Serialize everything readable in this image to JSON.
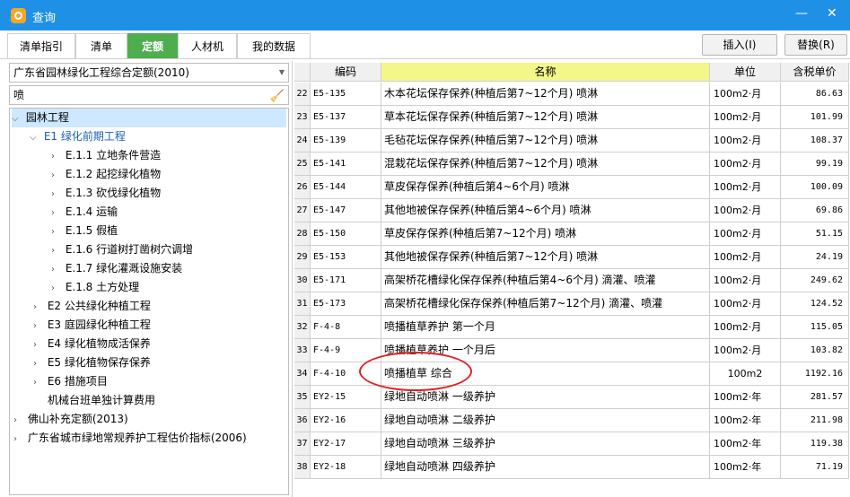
{
  "window": {
    "title": "查询",
    "minimize": "—",
    "close": "✕"
  },
  "tabs": [
    {
      "label": "清单指引"
    },
    {
      "label": "清单"
    },
    {
      "label": "定额"
    },
    {
      "label": "人材机"
    },
    {
      "label": "我的数据"
    }
  ],
  "toolbar": {
    "insert_label": "插入(I)",
    "replace_label": "替换(R)"
  },
  "left": {
    "library_select": "广东省园林绿化工程综合定额(2010)",
    "search_value": "喷",
    "tree": [
      {
        "label": "园林工程"
      },
      {
        "label": "E1 绿化前期工程"
      },
      {
        "label": "E.1.1 立地条件营造"
      },
      {
        "label": "E.1.2 起挖绿化植物"
      },
      {
        "label": "E.1.3 砍伐绿化植物"
      },
      {
        "label": "E.1.4 运输"
      },
      {
        "label": "E.1.5 假植"
      },
      {
        "label": "E.1.6 行道树打凿树穴调增"
      },
      {
        "label": "E.1.7 绿化灌溉设施安装"
      },
      {
        "label": "E.1.8 土方处理"
      },
      {
        "label": "E2 公共绿化种植工程"
      },
      {
        "label": "E3 庭园绿化种植工程"
      },
      {
        "label": "E4 绿化植物成活保养"
      },
      {
        "label": "E5 绿化植物保存保养"
      },
      {
        "label": "E6 措施项目"
      },
      {
        "label": "机械台班单独计算费用"
      },
      {
        "label": "佛山补充定额(2013)"
      },
      {
        "label": "广东省城市绿地常规养护工程估价指标(2006)"
      }
    ]
  },
  "table": {
    "headers": {
      "code": "编码",
      "name": "名称",
      "unit": "单位",
      "price": "含税单价"
    },
    "rows": [
      {
        "no": "22",
        "code": "E5-135",
        "name": "木本花坛保存保养(种植后第7~12个月) 喷淋",
        "unit": "100m2·月",
        "price": "86.63"
      },
      {
        "no": "23",
        "code": "E5-137",
        "name": "草本花坛保存保养(种植后第7~12个月) 喷淋",
        "unit": "100m2·月",
        "price": "101.99"
      },
      {
        "no": "24",
        "code": "E5-139",
        "name": "毛毡花坛保存保养(种植后第7~12个月) 喷淋",
        "unit": "100m2·月",
        "price": "108.37"
      },
      {
        "no": "25",
        "code": "E5-141",
        "name": "混栽花坛保存保养(种植后第7~12个月) 喷淋",
        "unit": "100m2·月",
        "price": "99.19"
      },
      {
        "no": "26",
        "code": "E5-144",
        "name": "草皮保存保养(种植后第4~6个月) 喷淋",
        "unit": "100m2·月",
        "price": "100.09"
      },
      {
        "no": "27",
        "code": "E5-147",
        "name": "其他地被保存保养(种植后第4~6个月) 喷淋",
        "unit": "100m2·月",
        "price": "69.86"
      },
      {
        "no": "28",
        "code": "E5-150",
        "name": "草皮保存保养(种植后第7~12个月) 喷淋",
        "unit": "100m2·月",
        "price": "51.15"
      },
      {
        "no": "29",
        "code": "E5-153",
        "name": "其他地被保存保养(种植后第7~12个月) 喷淋",
        "unit": "100m2·月",
        "price": "24.19"
      },
      {
        "no": "30",
        "code": "E5-171",
        "name": "高架桥花槽绿化保存保养(种植后第4~6个月) 滴灌、喷灌",
        "unit": "100m2·月",
        "price": "249.62"
      },
      {
        "no": "31",
        "code": "E5-173",
        "name": "高架桥花槽绿化保存保养(种植后第7~12个月) 滴灌、喷灌",
        "unit": "100m2·月",
        "price": "124.52"
      },
      {
        "no": "32",
        "code": "F-4-8",
        "name": "喷播植草养护 第一个月",
        "unit": "100m2·月",
        "price": "115.05"
      },
      {
        "no": "33",
        "code": "F-4-9",
        "name": "喷播植草养护 一个月后",
        "unit": "100m2·月",
        "price": "103.82"
      },
      {
        "no": "34",
        "code": "F-4-10",
        "name": "喷播植草 综合",
        "unit": "100m2",
        "price": "1192.16"
      },
      {
        "no": "35",
        "code": "EY2-15",
        "name": "绿地自动喷淋 一级养护",
        "unit": "100m2·年",
        "price": "281.57"
      },
      {
        "no": "36",
        "code": "EY2-16",
        "name": "绿地自动喷淋 二级养护",
        "unit": "100m2·年",
        "price": "211.98"
      },
      {
        "no": "37",
        "code": "EY2-17",
        "name": "绿地自动喷淋 三级养护",
        "unit": "100m2·年",
        "price": "119.38"
      },
      {
        "no": "38",
        "code": "EY2-18",
        "name": "绿地自动喷淋 四级养护",
        "unit": "100m2·年",
        "price": "71.19"
      }
    ]
  },
  "colors": {
    "titlebar": "#1e90e6",
    "active_tab": "#4eae4e",
    "name_header": "#f3f78a",
    "annotation": "#e02020"
  }
}
